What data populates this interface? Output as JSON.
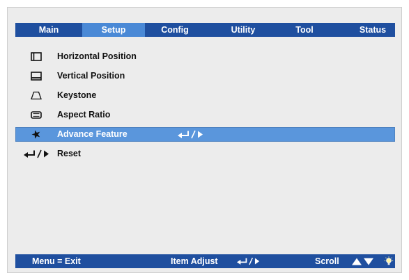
{
  "colors": {
    "page_bg": "#ffffff",
    "panel_bg": "#ececec",
    "panel_border": "#cdcdcd",
    "bar": "#1f4f9f",
    "active_tab": "#4a89d6",
    "selected_row": "#5a96dc",
    "text": "#111111",
    "bar_text": "#ffffff"
  },
  "tabs": [
    {
      "label": "Main",
      "active": false
    },
    {
      "label": "Setup",
      "active": true
    },
    {
      "label": "Config",
      "active": false
    },
    {
      "label": "Utility",
      "active": false
    },
    {
      "label": "Tool",
      "active": false
    },
    {
      "label": "Status",
      "active": false
    }
  ],
  "menu": {
    "items": [
      {
        "label": "Horizontal Position",
        "icon": "horizontal-position-icon",
        "selected": false
      },
      {
        "label": "Vertical Position",
        "icon": "vertical-position-icon",
        "selected": false
      },
      {
        "label": "Keystone",
        "icon": "keystone-icon",
        "selected": false
      },
      {
        "label": "Aspect Ratio",
        "icon": "aspect-ratio-icon",
        "selected": false
      },
      {
        "label": "Advance Feature",
        "icon": "advance-feature-icon",
        "selected": true,
        "action_icon": "enter-right-icon"
      },
      {
        "label": "Reset",
        "icon": "enter-right-icon",
        "selected": false
      }
    ]
  },
  "footer": {
    "exit_label": "Menu = Exit",
    "adjust_label": "Item Adjust",
    "adjust_icon": "enter-right-icon",
    "scroll_label": "Scroll",
    "scroll_icon": "up-down-arrows-icon",
    "status_icon": "lamp-icon"
  }
}
